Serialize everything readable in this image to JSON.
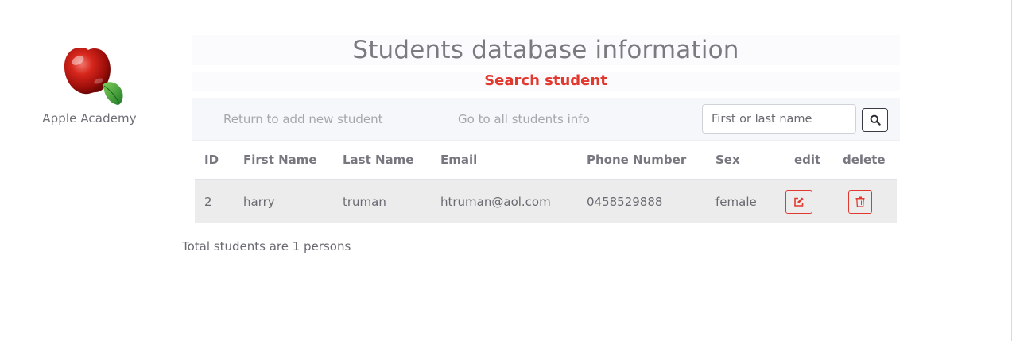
{
  "brand": {
    "name": "Apple Academy",
    "logo_icon": "apple-logo-icon"
  },
  "header": {
    "title": "Students database information",
    "subtitle": "Search student",
    "subtitle_color": "#e2392f"
  },
  "nav": {
    "add_link": "Return to add new student",
    "all_link": "Go to all students info",
    "search_placeholder": "First or last name",
    "search_value": "",
    "search_icon": "search-icon"
  },
  "table": {
    "columns": [
      "ID",
      "First Name",
      "Last Name",
      "Email",
      "Phone Number",
      "Sex",
      "edit",
      "delete"
    ],
    "rows": [
      {
        "id": "2",
        "first_name": "harry",
        "last_name": "truman",
        "email": "htruman@aol.com",
        "phone": "0458529888",
        "sex": "female",
        "edit_icon": "edit-icon",
        "delete_icon": "trash-icon"
      }
    ]
  },
  "footer": {
    "total_text": "Total students are 1 persons"
  },
  "colors": {
    "accent": "#e2392f",
    "navbar_bg": "#f6f7fa",
    "row_bg": "#ececec"
  }
}
